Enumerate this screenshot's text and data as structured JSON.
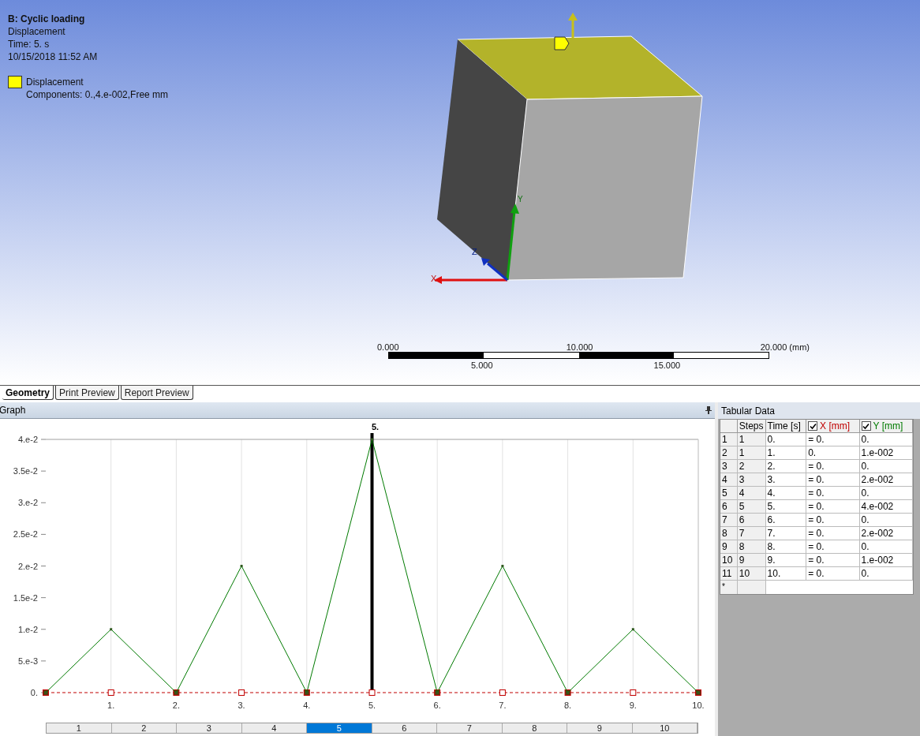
{
  "viewport": {
    "title": "B: Cyclic loading",
    "lines": [
      "Displacement",
      "Time: 5. s",
      "10/15/2018 11:52 AM"
    ],
    "legend": {
      "color": "#ffff00",
      "label": "Displacement",
      "detail": "Components: 0.,4.e-002,Free mm"
    },
    "triad": [
      "X",
      "Y",
      "Z"
    ],
    "scale_bar": {
      "top_labels": [
        "0.000",
        "10.000",
        "20.000 (mm)"
      ],
      "bottom_labels": [
        "5.000",
        "15.000"
      ]
    }
  },
  "tabs": [
    {
      "label": "Geometry",
      "selected": true
    },
    {
      "label": "Print Preview",
      "selected": false
    },
    {
      "label": "Report Preview",
      "selected": false
    }
  ],
  "graph": {
    "title": "Graph",
    "chart_data": {
      "type": "line",
      "x": [
        0,
        1,
        2,
        3,
        4,
        5,
        6,
        7,
        8,
        9,
        10
      ],
      "series": [
        {
          "name": "X [mm]",
          "color": "#c00000",
          "line_style": "dashed",
          "marker": "square",
          "values": [
            0,
            0,
            0,
            0,
            0,
            0,
            0,
            0,
            0,
            0,
            0
          ]
        },
        {
          "name": "Y [mm]",
          "color": "#007a00",
          "line_style": "solid",
          "marker": "square",
          "values": [
            0,
            0.01,
            0,
            0.02,
            0,
            0.04,
            0,
            0.02,
            0,
            0.01,
            0
          ]
        }
      ],
      "xlim": [
        0,
        10
      ],
      "ylim": [
        0,
        0.04
      ],
      "grid": true,
      "xticks": [
        {
          "value": 1,
          "label": "1."
        },
        {
          "value": 2,
          "label": "2."
        },
        {
          "value": 3,
          "label": "3."
        },
        {
          "value": 4,
          "label": "4."
        },
        {
          "value": 5,
          "label": "5."
        },
        {
          "value": 6,
          "label": "6."
        },
        {
          "value": 7,
          "label": "7."
        },
        {
          "value": 8,
          "label": "8."
        },
        {
          "value": 9,
          "label": "9."
        },
        {
          "value": 10,
          "label": "10."
        }
      ],
      "yticks": [
        {
          "value": 0,
          "label": "0."
        },
        {
          "value": 0.005,
          "label": "5.e-3"
        },
        {
          "value": 0.01,
          "label": "1.e-2"
        },
        {
          "value": 0.015,
          "label": "1.5e-2"
        },
        {
          "value": 0.02,
          "label": "2.e-2"
        },
        {
          "value": 0.025,
          "label": "2.5e-2"
        },
        {
          "value": 0.03,
          "label": "3.e-2"
        },
        {
          "value": 0.035,
          "label": "3.5e-2"
        },
        {
          "value": 0.04,
          "label": "4.e-2"
        }
      ],
      "ref_lines": [
        {
          "axis": "x",
          "value": 5,
          "color": "#000000",
          "label": "5."
        }
      ]
    },
    "steps": [
      {
        "label": "1",
        "selected": false
      },
      {
        "label": "2",
        "selected": false
      },
      {
        "label": "3",
        "selected": false
      },
      {
        "label": "4",
        "selected": false
      },
      {
        "label": "5",
        "selected": true
      },
      {
        "label": "6",
        "selected": false
      },
      {
        "label": "7",
        "selected": false
      },
      {
        "label": "8",
        "selected": false
      },
      {
        "label": "9",
        "selected": false
      },
      {
        "label": "10",
        "selected": false
      }
    ]
  },
  "tabular": {
    "title": "Tabular Data",
    "columns": [
      {
        "kind": "corner"
      },
      {
        "kind": "text",
        "label": "Steps"
      },
      {
        "kind": "text",
        "label": "Time [s]"
      },
      {
        "kind": "series",
        "checked": true
      },
      {
        "kind": "series",
        "checked": true
      }
    ],
    "rows": [
      [
        "1",
        "1",
        "0.",
        "= 0.",
        "0."
      ],
      [
        "2",
        "1",
        "1.",
        "0.",
        "1.e-002"
      ],
      [
        "3",
        "2",
        "2.",
        "= 0.",
        "0."
      ],
      [
        "4",
        "3",
        "3.",
        "= 0.",
        "2.e-002"
      ],
      [
        "5",
        "4",
        "4.",
        "= 0.",
        "0."
      ],
      [
        "6",
        "5",
        "5.",
        "= 0.",
        "4.e-002"
      ],
      [
        "7",
        "6",
        "6.",
        "= 0.",
        "0."
      ],
      [
        "8",
        "7",
        "7.",
        "= 0.",
        "2.e-002"
      ],
      [
        "9",
        "8",
        "8.",
        "= 0.",
        "0."
      ],
      [
        "10",
        "9",
        "9.",
        "= 0.",
        "1.e-002"
      ],
      [
        "11",
        "10",
        "10.",
        "= 0.",
        "0."
      ]
    ],
    "new_row_marker": "*"
  }
}
